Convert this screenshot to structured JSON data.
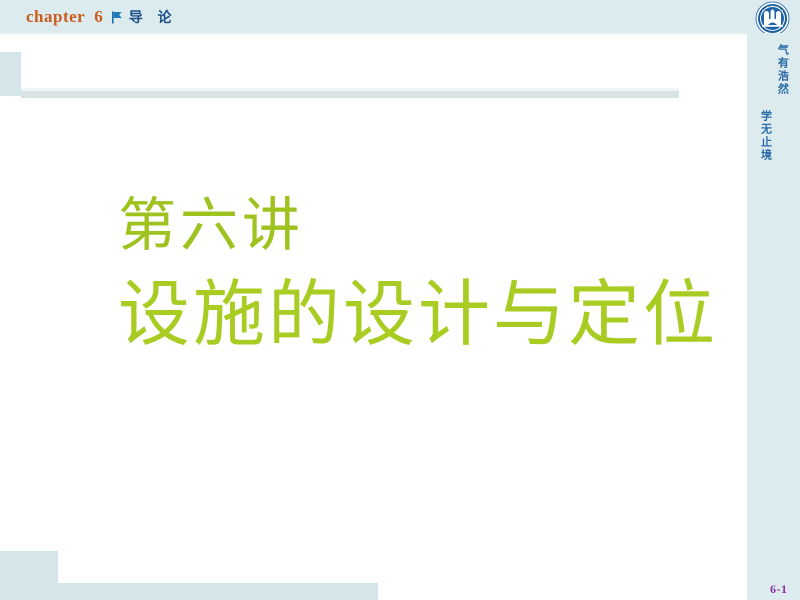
{
  "slide": {
    "page_number": "6-1",
    "background_color": "#ffffff"
  },
  "header": {
    "chapter_word": "chapter",
    "chapter_number": "6",
    "bullet_icon": "flag-icon",
    "section_label": "导  论",
    "band_color": "#dcebee",
    "chapter_color": "#cc5c1b",
    "section_color": "#1c4f86"
  },
  "branding": {
    "logo_icon": "university-seal-icon",
    "logo_color": "#1b5fa0",
    "motto_column_1": "气有浩然",
    "motto_column_2": "学无止境"
  },
  "title": {
    "lecture_label": "第六讲",
    "main_title": "设施的设计与定位",
    "accent_color": "#a8cc22"
  },
  "decor": {
    "accent_block_color": "#d4e6ea",
    "divider_color": "#d7e3e5"
  }
}
